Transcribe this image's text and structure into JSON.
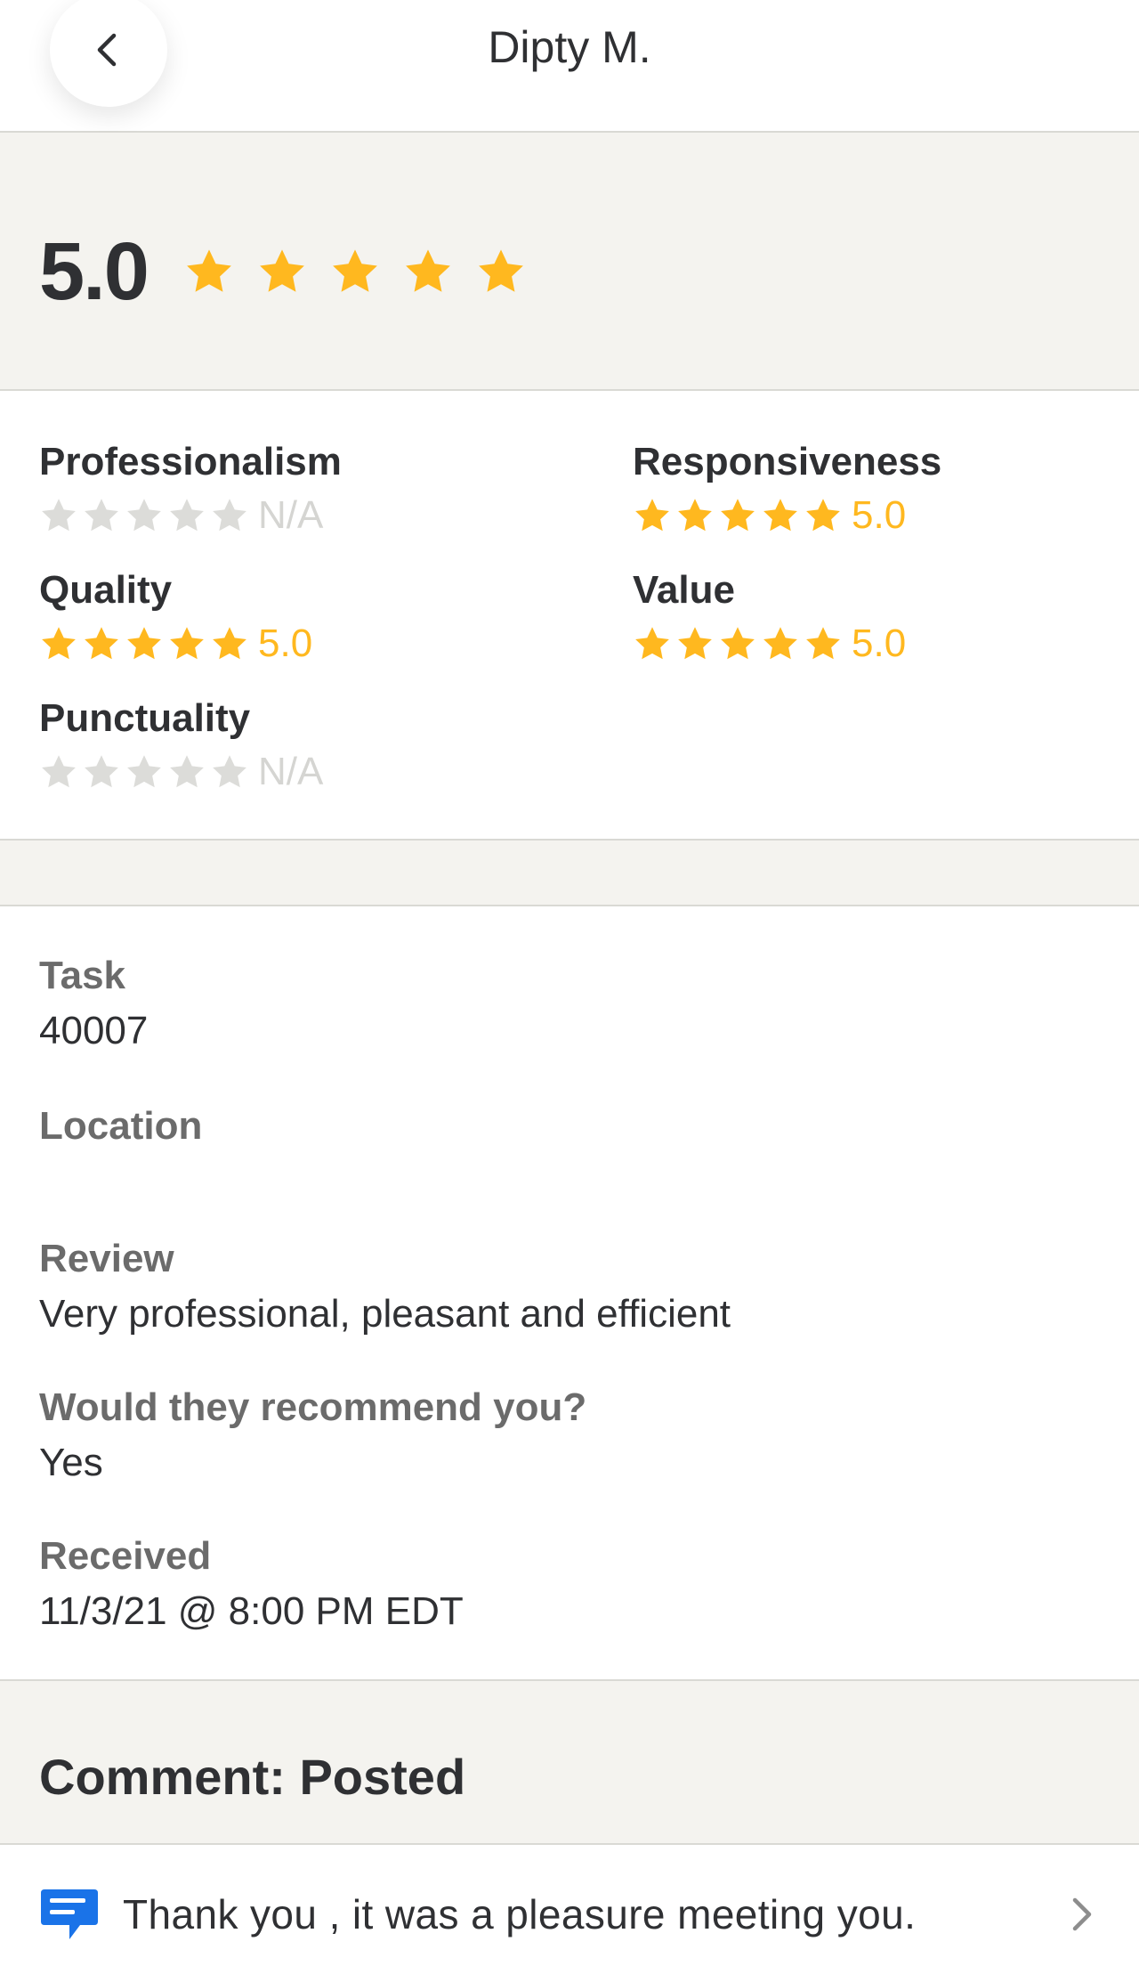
{
  "header": {
    "title": "Dipty M.",
    "back_icon": "chevron-left-icon"
  },
  "overall": {
    "score": "5.0",
    "stars_filled": 5,
    "stars_total": 5,
    "star_color": "#FFB81F"
  },
  "breakdown": {
    "empty_star_color": "#DCDCD9",
    "metrics": [
      {
        "label": "Professionalism",
        "value": "N/A",
        "stars": 0
      },
      {
        "label": "Responsiveness",
        "value": "5.0",
        "stars": 5
      },
      {
        "label": "Quality",
        "value": "5.0",
        "stars": 5
      },
      {
        "label": "Value",
        "value": "5.0",
        "stars": 5
      },
      {
        "label": "Punctuality",
        "value": "N/A",
        "stars": 0
      }
    ]
  },
  "details": {
    "task": {
      "label": "Task",
      "value": "40007"
    },
    "location": {
      "label": "Location",
      "value": ""
    },
    "review": {
      "label": "Review",
      "value": "Very professional, pleasant and efficient"
    },
    "recommend": {
      "label": "Would they recommend you?",
      "value": "Yes"
    },
    "received": {
      "label": "Received",
      "value": "11/3/21 @ 8:00 PM EDT"
    }
  },
  "comment": {
    "title": "Comment: Posted",
    "text": "Thank you , it was a pleasure meeting you.",
    "icon": "message-icon",
    "icon_color": "#1A73E8",
    "chevron_icon": "chevron-right-icon"
  }
}
